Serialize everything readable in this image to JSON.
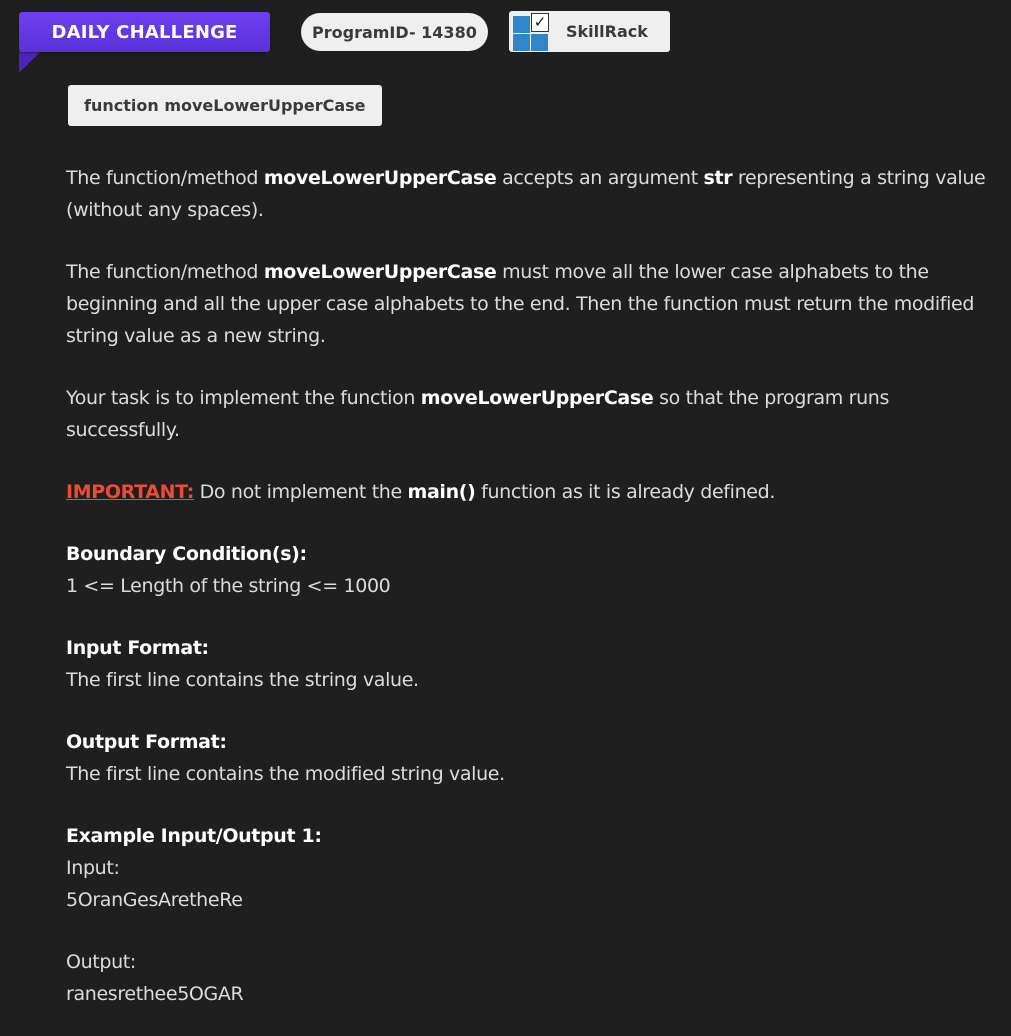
{
  "header": {
    "challenge_label": "DAILY CHALLENGE",
    "program_id": "ProgramID- 14380",
    "brand": "SkillRack",
    "brand_check": "✓",
    "function_badge": "function moveLowerUpperCase"
  },
  "colors": {
    "ribbon": "#6d3ff0",
    "important": "#ef4a33",
    "logo_blue": "#2f86c9",
    "background": "#1f1f20"
  },
  "description": {
    "p1": {
      "a": "The function/method ",
      "b": "moveLowerUpperCase",
      "c": " accepts an argument ",
      "d": "str",
      "e": " representing a string value (without any spaces)."
    },
    "p2": {
      "a": "The function/method ",
      "b": "moveLowerUpperCase",
      "c": " must move all the lower case alphabets to the beginning and all the upper case alphabets to the end. Then the function must return the modified string value as a new string."
    },
    "p3": {
      "a": "Your task is to implement the function ",
      "b": "moveLowerUpperCase",
      "c": " so that the program runs successfully."
    },
    "important": {
      "label": "IMPORTANT:",
      "a": " Do not implement the ",
      "b": "main()",
      "c": " function as it is already defined."
    }
  },
  "sections": {
    "boundary": {
      "heading": "Boundary Condition(s):",
      "text": "1 <= Length of the string <= 1000"
    },
    "input_format": {
      "heading": "Input Format:",
      "text": "The first line contains the string value."
    },
    "output_format": {
      "heading": "Output Format:",
      "text": "The first line contains the modified string value."
    },
    "example": {
      "heading": "Example Input/Output 1:",
      "input_label": "Input:",
      "input_value": "5OranGesAretheRe",
      "output_label": "Output:",
      "output_value": "ranesrethee5OGAR"
    }
  }
}
